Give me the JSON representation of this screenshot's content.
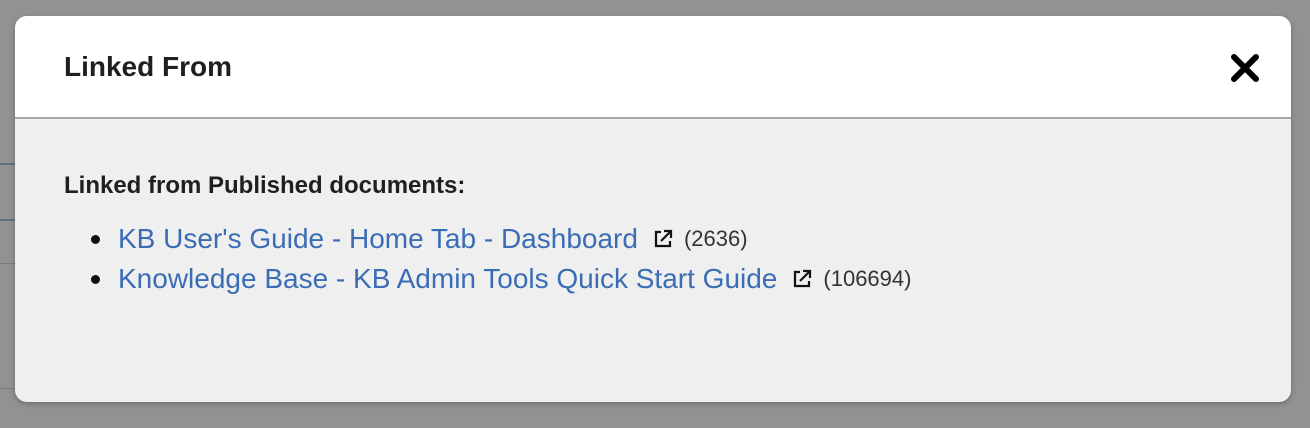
{
  "dialog": {
    "title": "Linked From",
    "close_icon": "close-icon"
  },
  "body": {
    "section_label": "Linked from Published documents:",
    "documents": [
      {
        "title": "KB User's Guide - Home Tab - Dashboard",
        "id": "(2636)",
        "icon": "external-link-icon"
      },
      {
        "title": "Knowledge Base - KB Admin Tools Quick Start Guide",
        "id": "(106694)",
        "icon": "external-link-icon"
      }
    ]
  },
  "colors": {
    "overlay": "#929292",
    "header_bg": "#ffffff",
    "body_bg": "#efefef",
    "link": "#3a6db5",
    "text": "#1f1f1f"
  }
}
